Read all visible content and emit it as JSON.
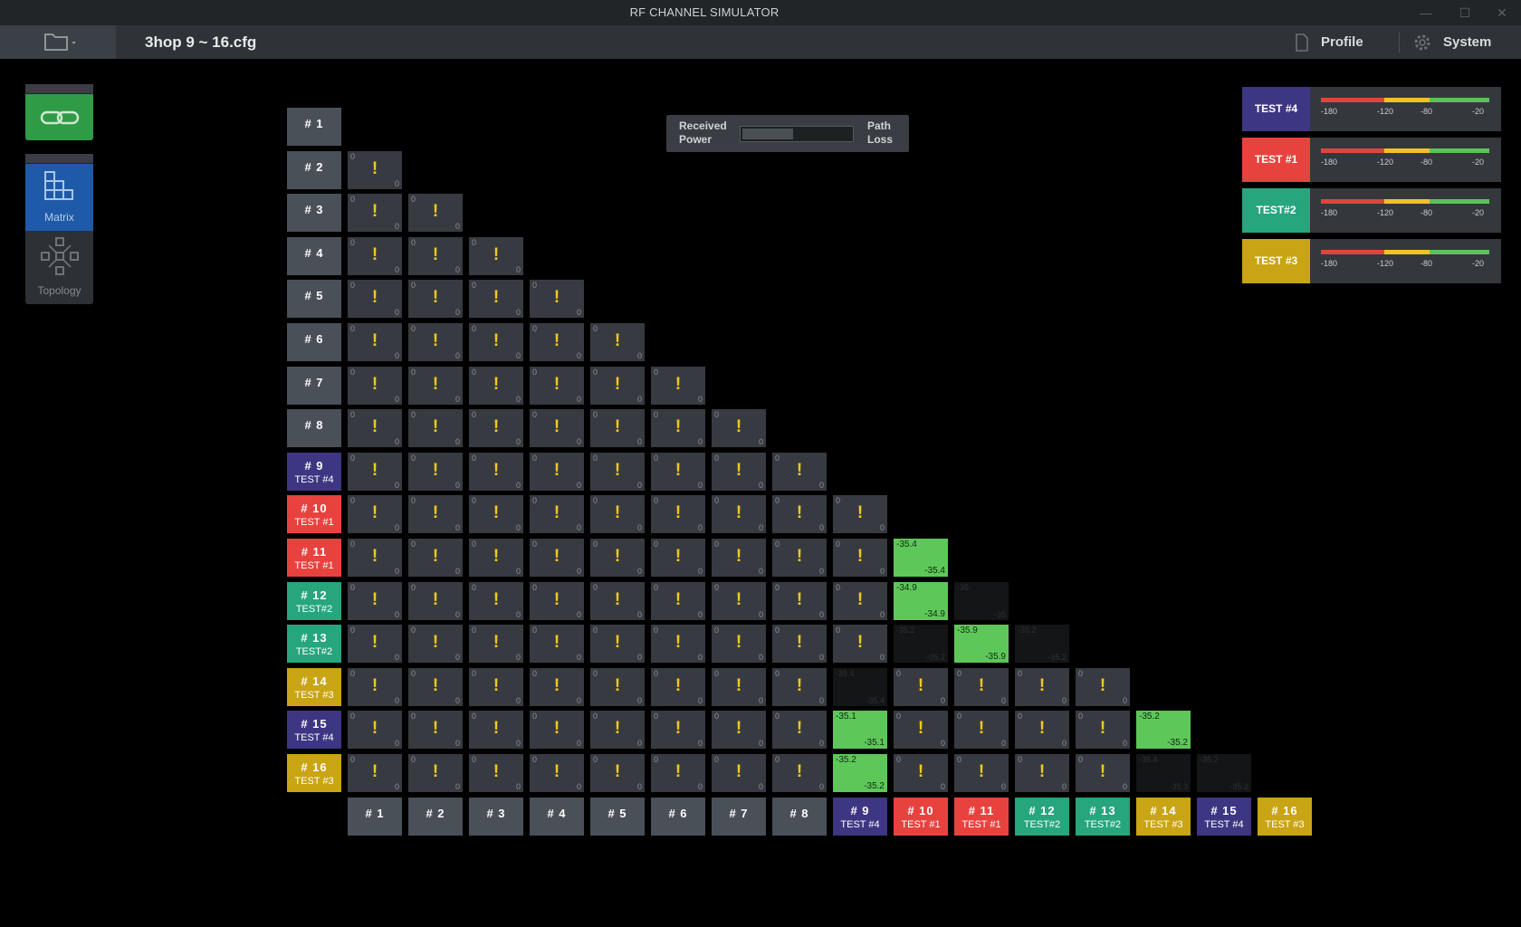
{
  "titlebar": {
    "title": "RF CHANNEL SIMULATOR",
    "minimize": "—",
    "maximize": "☐",
    "close": "✕"
  },
  "toolbar": {
    "filename": "3hop 9 ~ 16.cfg",
    "profile": "Profile",
    "system": "System"
  },
  "sidebar": {
    "matrix_label": "Matrix",
    "topology_label": "Topology"
  },
  "legend": {
    "received": "Received Power",
    "path_loss": "Path Loss"
  },
  "colors": {
    "TEST #4": "#3d3683",
    "TEST #1": "#e8423f",
    "TEST#2": "#27a57d",
    "TEST #3": "#c9a414",
    "green": "#5ec75a",
    "port": "#4a5058"
  },
  "ports": [
    {
      "name": "# 1",
      "test": ""
    },
    {
      "name": "# 2",
      "test": ""
    },
    {
      "name": "# 3",
      "test": ""
    },
    {
      "name": "# 4",
      "test": ""
    },
    {
      "name": "# 5",
      "test": ""
    },
    {
      "name": "# 6",
      "test": ""
    },
    {
      "name": "# 7",
      "test": ""
    },
    {
      "name": "# 8",
      "test": ""
    },
    {
      "name": "# 9",
      "test": "TEST #4"
    },
    {
      "name": "# 10",
      "test": "TEST #1"
    },
    {
      "name": "# 11",
      "test": "TEST #1"
    },
    {
      "name": "# 12",
      "test": "TEST#2"
    },
    {
      "name": "# 13",
      "test": "TEST#2"
    },
    {
      "name": "# 14",
      "test": "TEST #3"
    },
    {
      "name": "# 15",
      "test": "TEST #4"
    },
    {
      "name": "# 16",
      "test": "TEST #3"
    }
  ],
  "links": {
    "11-10": {
      "type": "green",
      "top": "-35.4",
      "bottom": "-35.4"
    },
    "12-10": {
      "type": "green",
      "top": "-34.9",
      "bottom": "-34.9"
    },
    "12-11": {
      "type": "dim",
      "top": "-35",
      "bottom": "-35"
    },
    "13-10": {
      "type": "dim",
      "top": "-35.2",
      "bottom": "-35.2"
    },
    "13-11": {
      "type": "green",
      "top": "-35.9",
      "bottom": "-35.9"
    },
    "13-12": {
      "type": "dim",
      "top": "-35.2",
      "bottom": "-35.2"
    },
    "14-9": {
      "type": "dim",
      "top": "-35.4",
      "bottom": "-35.4"
    },
    "15-9": {
      "type": "green",
      "top": "-35.1",
      "bottom": "-35.1"
    },
    "15-14": {
      "type": "green",
      "top": "-35.2",
      "bottom": "-35.2"
    },
    "16-9": {
      "type": "green",
      "top": "-35.2",
      "bottom": "-35.2"
    },
    "16-14": {
      "type": "dim",
      "top": "-35.4",
      "bottom": "-35.3"
    },
    "16-15": {
      "type": "dim",
      "top": "-35.2",
      "bottom": "-35.2"
    }
  },
  "default_link": {
    "top": "0",
    "bottom": "0",
    "mark": "!"
  },
  "meters": [
    {
      "tag": "TEST #4",
      "color": "#3d3683",
      "ticks": [
        "-180",
        "-120",
        "-80",
        "-20"
      ]
    },
    {
      "tag": "TEST #1",
      "color": "#e8423f",
      "ticks": [
        "-180",
        "-120",
        "-80",
        "-20"
      ]
    },
    {
      "tag": "TEST#2",
      "color": "#27a57d",
      "ticks": [
        "-180",
        "-120",
        "-80",
        "-20"
      ]
    },
    {
      "tag": "TEST #3",
      "color": "#c9a414",
      "ticks": [
        "-180",
        "-120",
        "-80",
        "-20"
      ]
    }
  ]
}
